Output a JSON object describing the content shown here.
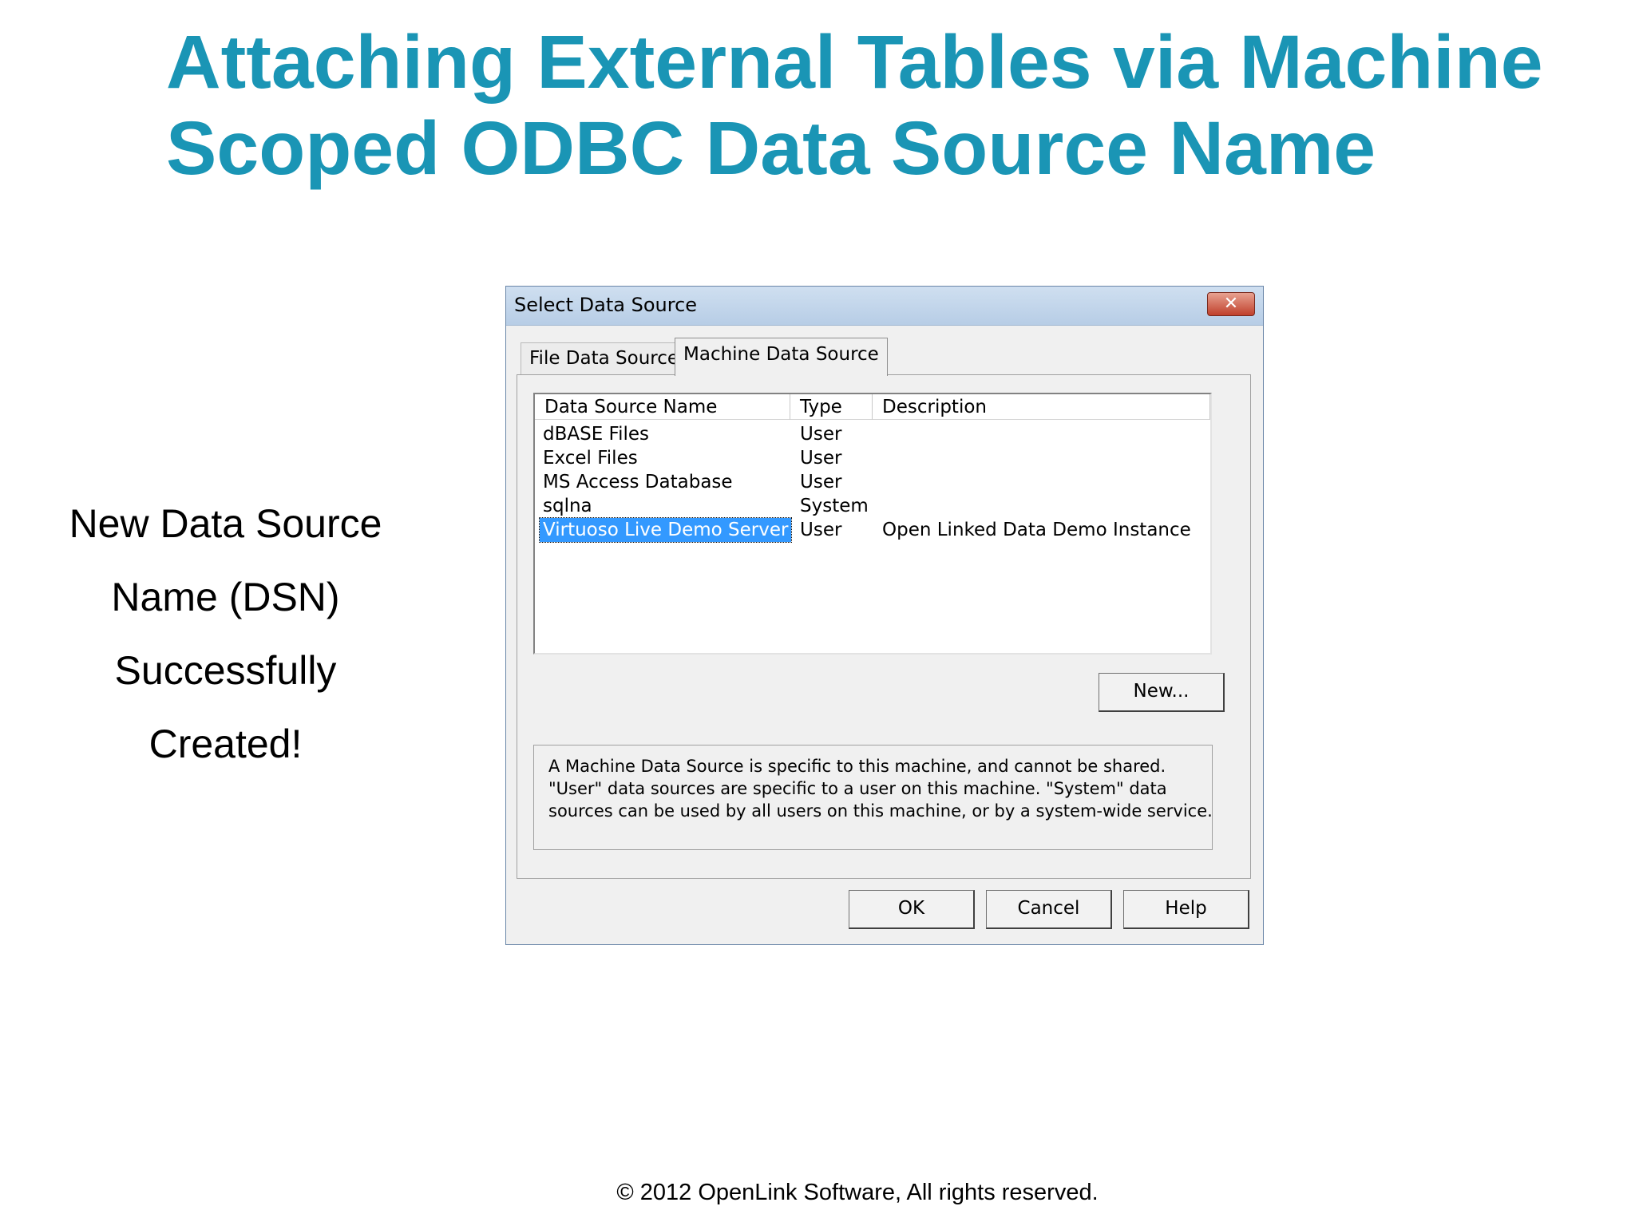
{
  "slide": {
    "title_line1": "Attaching External Tables via Machine",
    "title_line2": "Scoped ODBC Data Source Name",
    "side_text": [
      "New Data Source",
      "Name (DSN)",
      "Successfully",
      "Created!"
    ],
    "footer": "© 2012 OpenLink Software, All rights reserved."
  },
  "dialog": {
    "title": "Select Data Source",
    "close_glyph": "✕",
    "tabs": [
      {
        "label": "File Data Source",
        "active": false
      },
      {
        "label": "Machine Data Source",
        "active": true
      }
    ],
    "columns": [
      "Data Source Name",
      "Type",
      "Description"
    ],
    "rows": [
      {
        "name": "dBASE Files",
        "type": "User",
        "description": ""
      },
      {
        "name": "Excel Files",
        "type": "User",
        "description": ""
      },
      {
        "name": "MS Access Database",
        "type": "User",
        "description": ""
      },
      {
        "name": "sqlna",
        "type": "System",
        "description": ""
      },
      {
        "name": "Virtuoso Live Demo Server",
        "type": "User",
        "description": "Open Linked Data Demo Instance",
        "selected": true
      }
    ],
    "new_button": "New...",
    "info_lines": [
      "A Machine Data Source is specific to this machine, and cannot be shared.",
      "\"User\" data sources are specific to a user on this machine.  \"System\" data",
      "sources can be used by all users on this machine, or by a system-wide service."
    ],
    "buttons": {
      "ok": "OK",
      "cancel": "Cancel",
      "help": "Help"
    }
  },
  "colors": {
    "title": "#1a95b5",
    "selection": "#3399ff"
  }
}
